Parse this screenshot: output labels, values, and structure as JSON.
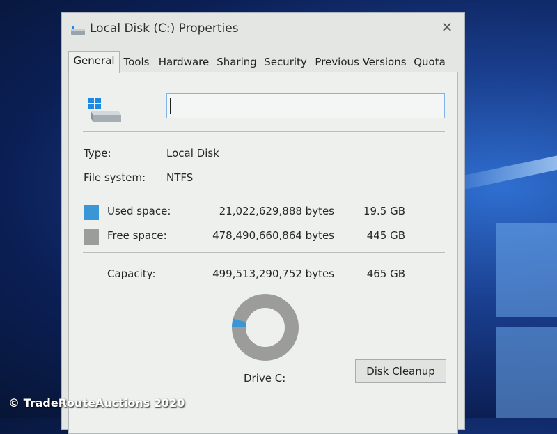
{
  "window": {
    "title": "Local Disk (C:) Properties",
    "close_glyph": "✕"
  },
  "tabs": [
    {
      "label": "General",
      "active": true
    },
    {
      "label": "Tools"
    },
    {
      "label": "Hardware"
    },
    {
      "label": "Sharing"
    },
    {
      "label": "Security"
    },
    {
      "label": "Previous Versions"
    },
    {
      "label": "Quota"
    }
  ],
  "general": {
    "name_value": "",
    "type_label": "Type:",
    "type_value": "Local Disk",
    "fs_label": "File system:",
    "fs_value": "NTFS",
    "used": {
      "label": "Used space:",
      "bytes": "21,022,629,888 bytes",
      "size": "19.5 GB",
      "fraction": 0.042
    },
    "free": {
      "label": "Free space:",
      "bytes": "478,490,660,864 bytes",
      "size": "445 GB"
    },
    "capacity": {
      "label": "Capacity:",
      "bytes": "499,513,290,752 bytes",
      "size": "465 GB"
    },
    "drive_label": "Drive C:",
    "cleanup_label": "Disk Cleanup"
  },
  "watermark": "© TradeRouteAuctions 2020",
  "colors": {
    "used": "#3a96d6",
    "free": "#9c9d9b",
    "accent_border": "#7eb4ea"
  }
}
